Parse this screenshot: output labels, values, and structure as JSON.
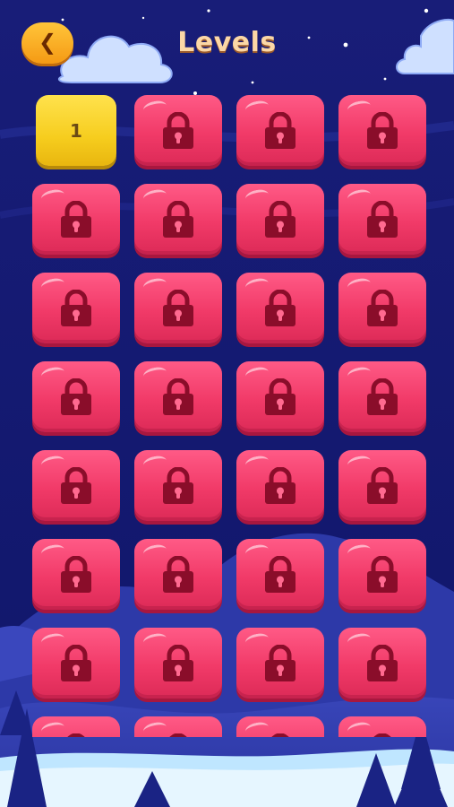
{
  "header": {
    "title": "Levels",
    "back_icon": "chevron-left-icon"
  },
  "colors": {
    "background": "#141a6e",
    "tile_locked": "#f13a68",
    "tile_unlocked": "#f6cd1e",
    "lock": "#8a0d2a",
    "title": "#fbd7a6",
    "back_button": "#f5a623"
  },
  "levels": [
    {
      "label": "1",
      "locked": false
    },
    {
      "label": "",
      "locked": true
    },
    {
      "label": "",
      "locked": true
    },
    {
      "label": "",
      "locked": true
    },
    {
      "label": "",
      "locked": true
    },
    {
      "label": "",
      "locked": true
    },
    {
      "label": "",
      "locked": true
    },
    {
      "label": "",
      "locked": true
    },
    {
      "label": "",
      "locked": true
    },
    {
      "label": "",
      "locked": true
    },
    {
      "label": "",
      "locked": true
    },
    {
      "label": "",
      "locked": true
    },
    {
      "label": "",
      "locked": true
    },
    {
      "label": "",
      "locked": true
    },
    {
      "label": "",
      "locked": true
    },
    {
      "label": "",
      "locked": true
    },
    {
      "label": "",
      "locked": true
    },
    {
      "label": "",
      "locked": true
    },
    {
      "label": "",
      "locked": true
    },
    {
      "label": "",
      "locked": true
    },
    {
      "label": "",
      "locked": true
    },
    {
      "label": "",
      "locked": true
    },
    {
      "label": "",
      "locked": true
    },
    {
      "label": "",
      "locked": true
    },
    {
      "label": "",
      "locked": true
    },
    {
      "label": "",
      "locked": true
    },
    {
      "label": "",
      "locked": true
    },
    {
      "label": "",
      "locked": true
    },
    {
      "label": "",
      "locked": true
    },
    {
      "label": "",
      "locked": true
    },
    {
      "label": "",
      "locked": true
    },
    {
      "label": "",
      "locked": true
    }
  ]
}
